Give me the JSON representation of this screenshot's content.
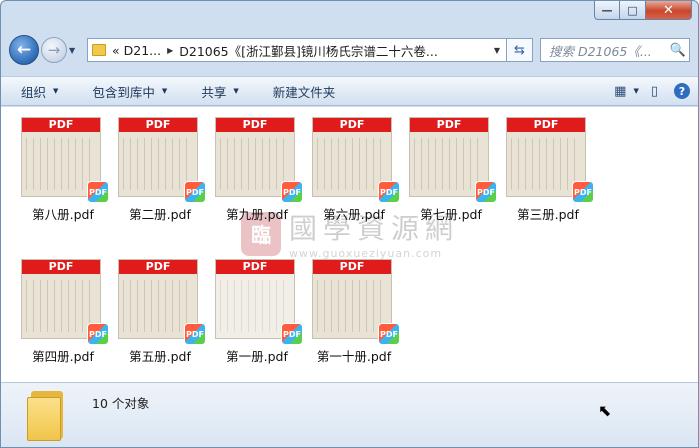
{
  "window": {
    "caption_min": "—",
    "caption_max": "□",
    "caption_close": "✕"
  },
  "address": {
    "back_glyph": "←",
    "forward_glyph": "→",
    "crumb_1": "«  D21...",
    "crumb_2": "D21065《[浙江鄞县]镜川杨氏宗谱二十六卷...",
    "search_placeholder": "搜索 D21065《..."
  },
  "toolbar": {
    "organize": "组织",
    "include_in_library": "包含到库中",
    "share": "共享",
    "new_folder": "新建文件夹"
  },
  "files": [
    {
      "name": "第八册.pdf",
      "band": "PDF",
      "badge": "PDF"
    },
    {
      "name": "第二册.pdf",
      "band": "PDF",
      "badge": "PDF"
    },
    {
      "name": "第九册.pdf",
      "band": "PDF",
      "badge": "PDF"
    },
    {
      "name": "第六册.pdf",
      "band": "PDF",
      "badge": "PDF"
    },
    {
      "name": "第七册.pdf",
      "band": "PDF",
      "badge": "PDF"
    },
    {
      "name": "第三册.pdf",
      "band": "PDF",
      "badge": "PDF"
    },
    {
      "name": "第四册.pdf",
      "band": "PDF",
      "badge": "PDF"
    },
    {
      "name": "第五册.pdf",
      "band": "PDF",
      "badge": "PDF"
    },
    {
      "name": "第一册.pdf",
      "band": "PDF",
      "badge": "PDF"
    },
    {
      "name": "第一十册.pdf",
      "band": "PDF",
      "badge": "PDF"
    }
  ],
  "watermark": {
    "seal": "臨",
    "title": "國學資源網",
    "url": "www.guoxueziyuan.com"
  },
  "details": {
    "count_text": "10 个对象"
  }
}
